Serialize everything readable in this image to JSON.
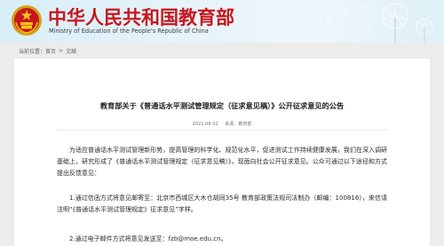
{
  "header": {
    "site_title": "中华人民共和国教育部",
    "site_subtitle": "Ministry of Education of the People's Republic of China",
    "emblem_icon": "national-emblem-icon",
    "decoration_icon": "dandelion-decoration",
    "accent_color": "#c8161d"
  },
  "breadcrumb": {
    "prefix": "当前位置：",
    "items": [
      "首页",
      "文献"
    ],
    "separator": ">"
  },
  "article": {
    "title": "教育部关于《普通话水平测试管理规定（征求意见稿）》公开征求意见的公告",
    "date": "2021-08-02",
    "source": "来源：教育部",
    "paragraphs": [
      "为适应普通话水平测试管理新形势，提高管理的科学化、规范化水平，促进测试工作持续健康发展，我们在深入调研基础上，研究形成了《普通话水平测试管理规定（征求意见稿）》，现面向社会公开征求意见。公众可通过以下途径和方式提出反馈意见：",
      "1.通过信函方式将意见邮寄至：北京市西城区大木仓胡同35号 教育部政策法规司法制办（邮编：100816），来信请注明“《普通话水平测试管理规定》征求意见”字样。",
      "2.通过电子邮件方式将意见发送至：fzb@moe.edu.cn。"
    ]
  }
}
